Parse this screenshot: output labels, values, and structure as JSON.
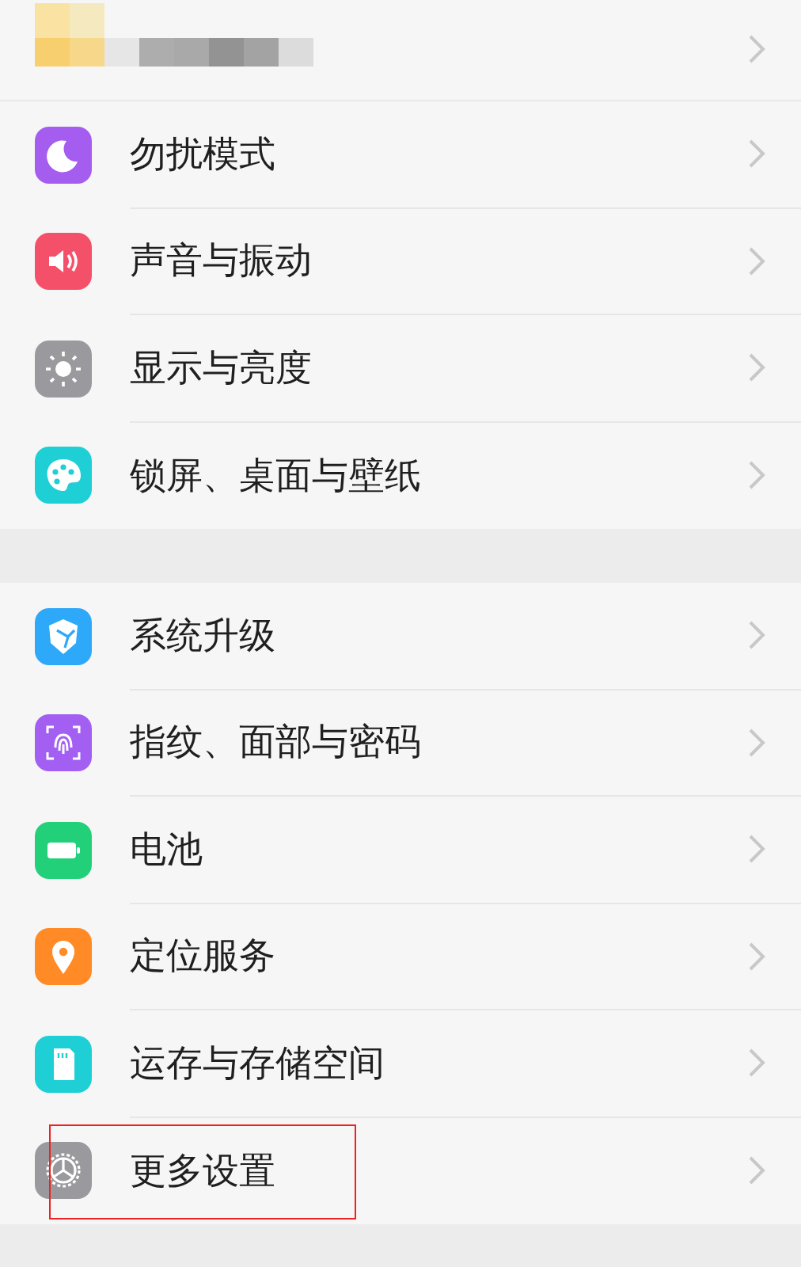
{
  "groups": [
    {
      "items": [
        {
          "kind": "redacted"
        },
        {
          "kind": "setting",
          "label": "勿扰模式",
          "color": "#a55df0"
        },
        {
          "kind": "setting",
          "label": "声音与振动",
          "color": "#f5506a"
        },
        {
          "kind": "setting",
          "label": "显示与亮度",
          "color": "#9a9a9e"
        },
        {
          "kind": "setting",
          "label": "锁屏、桌面与壁纸",
          "color": "#1fcfd6"
        }
      ]
    },
    {
      "items": [
        {
          "kind": "setting",
          "label": "系统升级",
          "color": "#2ea8f8"
        },
        {
          "kind": "setting",
          "label": "指纹、面部与密码",
          "color": "#a25ff2"
        },
        {
          "kind": "setting",
          "label": "电池",
          "color": "#22d07a"
        },
        {
          "kind": "setting",
          "label": "定位服务",
          "color": "#ff8a26"
        },
        {
          "kind": "setting",
          "label": "运存与存储空间",
          "color": "#1fcfd6"
        },
        {
          "kind": "setting",
          "label": "更多设置",
          "color": "#9a9a9e",
          "highlighted": true
        }
      ]
    }
  ]
}
